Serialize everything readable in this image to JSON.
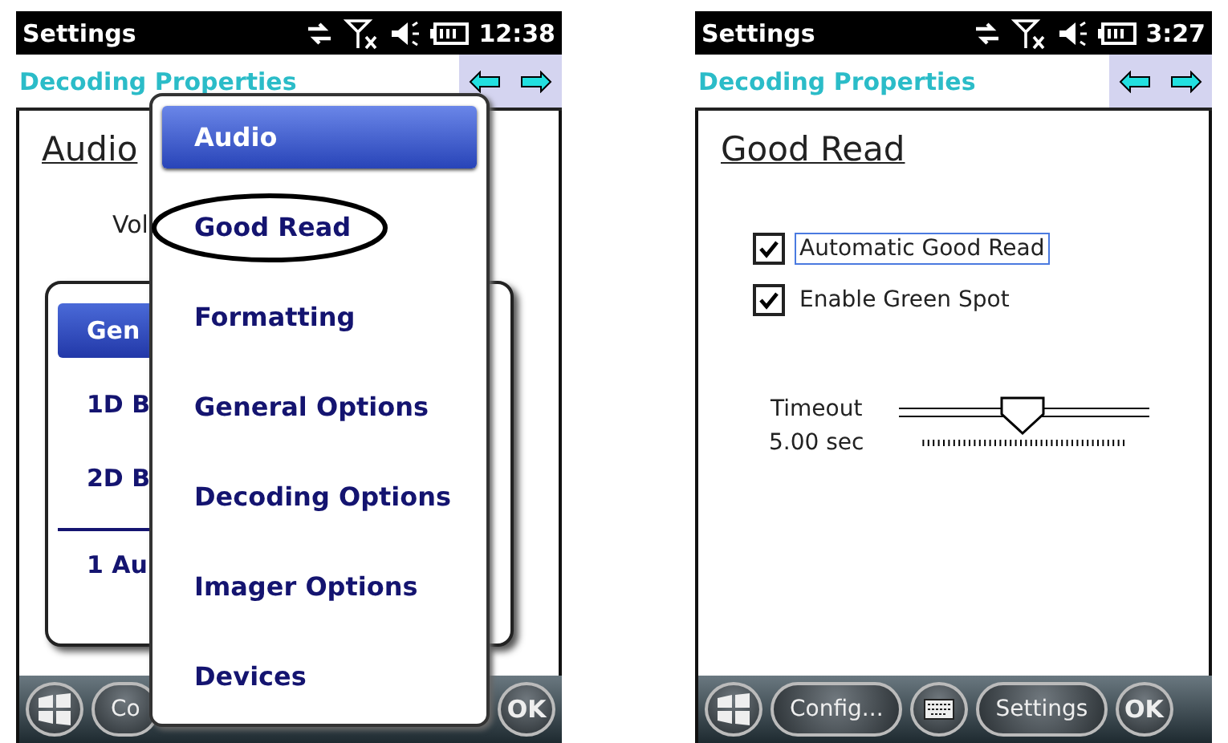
{
  "screens": [
    {
      "kind": "menu",
      "status_bar": {
        "title": "Settings",
        "time": "12:38"
      },
      "header": {
        "title": "Decoding Properties"
      },
      "heading": "Audio",
      "field_label": "Vol",
      "dialog": {
        "items": [
          {
            "label": "Gen",
            "selected": true,
            "kind": "page"
          },
          {
            "label": "1D B",
            "selected": false,
            "kind": "page"
          },
          {
            "label": "2D B",
            "selected": false,
            "kind": "page"
          },
          {
            "label": "1 Au",
            "selected": false,
            "kind": "recent"
          }
        ]
      },
      "menu": {
        "items": [
          {
            "label": "Audio",
            "selected": true
          },
          {
            "label": "Good Read",
            "selected": false,
            "circled": true
          },
          {
            "label": "Formatting",
            "selected": false,
            "circled": false
          },
          {
            "label": "General Options",
            "selected": false,
            "circled": false
          },
          {
            "label": "Decoding Options",
            "selected": false,
            "circled": false
          },
          {
            "label": "Imager Options",
            "selected": false,
            "circled": false
          },
          {
            "label": "Devices",
            "selected": false,
            "circled": false
          }
        ]
      },
      "taskbar": [
        {
          "kind": "start"
        },
        {
          "kind": "text",
          "label": "Co"
        },
        {
          "kind": "ok",
          "label": "OK"
        }
      ]
    },
    {
      "kind": "form",
      "status_bar": {
        "title": "Settings",
        "time": "3:27"
      },
      "header": {
        "title": "Decoding Properties"
      },
      "heading": "Good Read",
      "checkboxes": [
        {
          "label": "Automatic Good Read",
          "checked": true,
          "focused": true
        },
        {
          "label": "Enable Green Spot",
          "checked": true,
          "focused": false
        }
      ],
      "slider": {
        "label": "Timeout",
        "reading": "5.00 sec",
        "level": 0.49
      },
      "taskbar": [
        {
          "kind": "start"
        },
        {
          "kind": "text",
          "label": "Config..."
        },
        {
          "kind": "keyboard"
        },
        {
          "kind": "text",
          "label": "Settings"
        },
        {
          "kind": "ok",
          "label": "OK"
        }
      ]
    }
  ]
}
